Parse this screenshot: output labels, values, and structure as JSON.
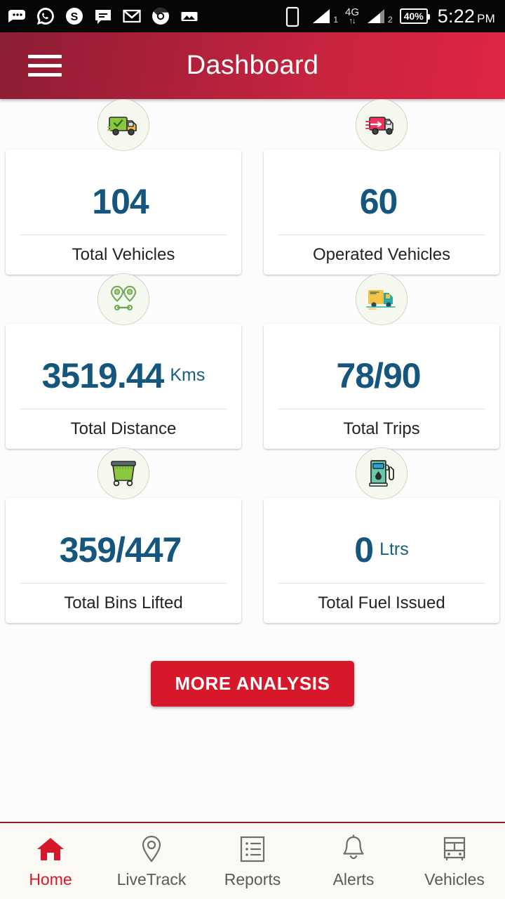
{
  "status_bar": {
    "notification_icons": [
      "messages-icon",
      "whatsapp-icon",
      "skype-icon",
      "sms-icon",
      "gmail-icon",
      "chrome-icon",
      "photo-icon"
    ],
    "device_icon": "phone-icon",
    "signal_1_label": "1",
    "network_type": "4G",
    "signal_2_label": "2",
    "battery_level": "40%",
    "time": "5:22",
    "am_pm": "PM"
  },
  "app_bar": {
    "menu_icon": "hamburger-menu-icon",
    "title": "Dashboard"
  },
  "cards": [
    {
      "icon": "truck-check-icon",
      "value": "104",
      "unit": "",
      "label": "Total Vehicles"
    },
    {
      "icon": "truck-moving-icon",
      "value": "60",
      "unit": "",
      "label": "Operated Vehicles"
    },
    {
      "icon": "route-pins-icon",
      "value": "3519.44",
      "unit": "Kms",
      "label": "Total Distance"
    },
    {
      "icon": "cargo-truck-icon",
      "value": "78/90",
      "unit": "",
      "label": "Total Trips"
    },
    {
      "icon": "garbage-bin-icon",
      "value": "359/447",
      "unit": "",
      "label": "Total Bins Lifted"
    },
    {
      "icon": "fuel-pump-icon",
      "value": "0",
      "unit": "Ltrs",
      "label": "Total Fuel Issued"
    }
  ],
  "more_analysis_button": "MORE ANALYSIS",
  "bottom_nav": {
    "items": [
      {
        "icon": "home-icon",
        "label": "Home",
        "active": true
      },
      {
        "icon": "map-pin-icon",
        "label": "LiveTrack",
        "active": false
      },
      {
        "icon": "reports-list-icon",
        "label": "Reports",
        "active": false
      },
      {
        "icon": "bell-icon",
        "label": "Alerts",
        "active": false
      },
      {
        "icon": "bus-front-icon",
        "label": "Vehicles",
        "active": false
      }
    ]
  },
  "colors": {
    "brand_red": "#D7182A",
    "appbar_gradient_start": "#8C1E33",
    "appbar_gradient_end": "#E02545",
    "value_blue": "#14567D",
    "nav_background": "#FBF9F3"
  }
}
